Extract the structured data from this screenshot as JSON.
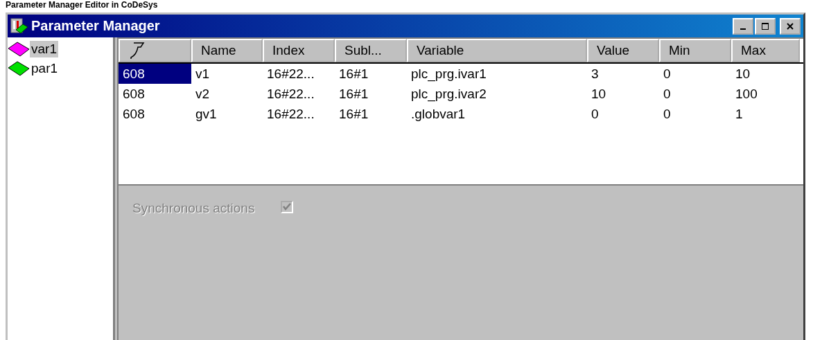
{
  "caption": "Parameter Manager Editor in CoDeSys",
  "window": {
    "title": "Parameter Manager"
  },
  "tree": {
    "items": [
      {
        "label": "var1",
        "color": "#ff00ff",
        "selected": true
      },
      {
        "label": "par1",
        "color": "#00e000",
        "selected": false
      }
    ]
  },
  "table": {
    "columns": [
      {
        "kind": "icon"
      },
      {
        "kind": "text",
        "label": "Name"
      },
      {
        "kind": "text",
        "label": "Index"
      },
      {
        "kind": "text",
        "label": "Subl..."
      },
      {
        "kind": "text",
        "label": "Variable"
      },
      {
        "kind": "text",
        "label": "Value"
      },
      {
        "kind": "text",
        "label": "Min"
      },
      {
        "kind": "text",
        "label": "Max"
      }
    ],
    "rows": [
      {
        "cells": [
          "608",
          "v1",
          "16#22...",
          "16#1",
          "plc_prg.ivar1",
          "3",
          "0",
          "10"
        ],
        "selected": true
      },
      {
        "cells": [
          "608",
          "v2",
          "16#22...",
          "16#1",
          "plc_prg.ivar2",
          "10",
          "0",
          "100"
        ],
        "selected": false
      },
      {
        "cells": [
          "608",
          "gv1",
          "16#22...",
          "16#1",
          ".globvar1",
          "0",
          "0",
          "1"
        ],
        "selected": false
      }
    ]
  },
  "options": {
    "label": "Synchronous actions",
    "checked": true,
    "disabled": true
  }
}
